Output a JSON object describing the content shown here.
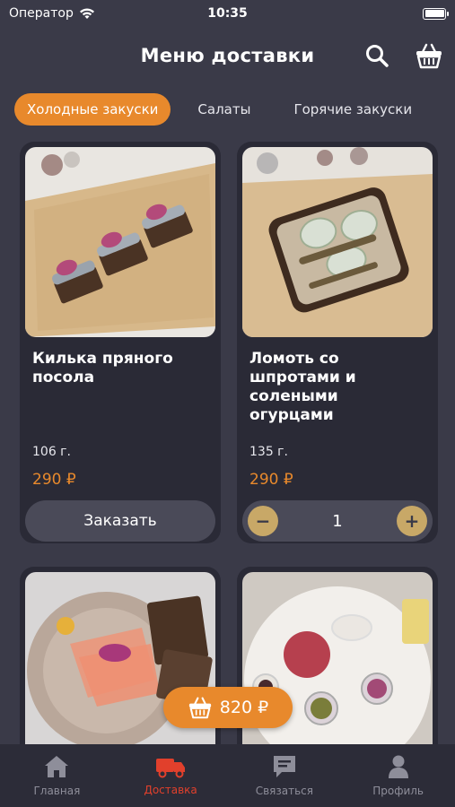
{
  "status": {
    "carrier": "Оператор",
    "time": "10:35"
  },
  "header": {
    "title": "Меню доставки"
  },
  "tabs": [
    {
      "label": "Холодные закуски",
      "active": true
    },
    {
      "label": "Салаты",
      "active": false
    },
    {
      "label": "Горячие закуски",
      "active": false
    }
  ],
  "products": [
    {
      "title": "Килька пряного посола",
      "weight": "106 г.",
      "price": "290 ₽",
      "action": "Заказать"
    },
    {
      "title": "Ломоть со шпротами и солеными огурцами",
      "weight": "135 г.",
      "price": "290 ₽",
      "quantity": "1",
      "minus": "−",
      "plus": "+"
    }
  ],
  "cart": {
    "total": "820 ₽"
  },
  "tabbar": [
    {
      "label": "Главная",
      "icon": "home-icon"
    },
    {
      "label": "Доставка",
      "icon": "delivery-truck-icon",
      "active": true
    },
    {
      "label": "Связаться",
      "icon": "chat-icon"
    },
    {
      "label": "Профиль",
      "icon": "profile-icon"
    }
  ],
  "colors": {
    "accent": "#e8892c",
    "active_tab": "#e1402c",
    "stepper": "#c8a867",
    "background": "#3a3a48"
  }
}
